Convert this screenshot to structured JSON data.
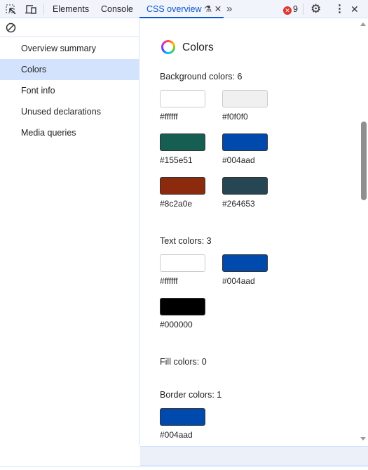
{
  "toolbar": {
    "tabs": [
      "Elements",
      "Console",
      "CSS overview"
    ],
    "more_tabs": "»",
    "error_count": "9",
    "accent": "#0b57d0"
  },
  "sidebar": {
    "items": [
      {
        "label": "Overview summary"
      },
      {
        "label": "Colors",
        "selected": true
      },
      {
        "label": "Font info"
      },
      {
        "label": "Unused declarations"
      },
      {
        "label": "Media queries"
      }
    ]
  },
  "main": {
    "title": "Colors",
    "background": {
      "label": "Background colors: 6",
      "colors": [
        "#ffffff",
        "#f0f0f0",
        "#155e51",
        "#004aad",
        "#8c2a0e",
        "#264653"
      ]
    },
    "text": {
      "label": "Text colors: 3",
      "colors": [
        "#ffffff",
        "#004aad",
        "#000000"
      ]
    },
    "fill": {
      "label": "Fill colors: 0"
    },
    "border": {
      "label": "Border colors: 1",
      "colors": [
        "#004aad"
      ]
    }
  }
}
